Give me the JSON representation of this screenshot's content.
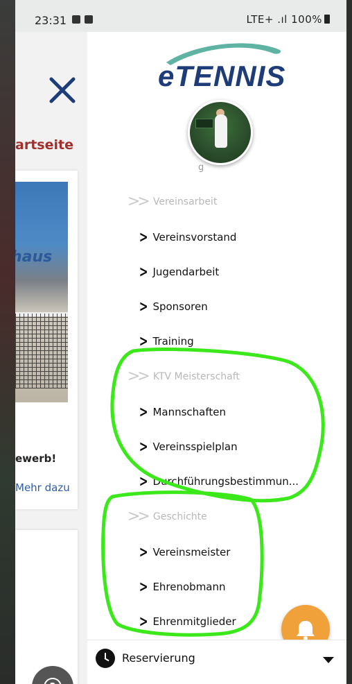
{
  "status_bar": {
    "time": "23:31",
    "network": "LTE+ .ıl",
    "battery": "100%"
  },
  "background_page": {
    "title": "artseite",
    "image_text": "haus",
    "promo_text": "ewerb!",
    "more_link": "Mehr dazu"
  },
  "drawer": {
    "logo_text": "eTENNIS",
    "cut_off_text": "g",
    "sections": [
      {
        "label": "Vereinsarbeit",
        "items": [
          "Vereinsvorstand",
          "Jugendarbeit",
          "Sponsoren",
          "Training"
        ]
      },
      {
        "label": "KTV Meisterschaft",
        "items": [
          "Mannschaften",
          "Vereinsspielplan",
          "Durchführungsbestimmun..."
        ]
      },
      {
        "label": "Geschichte",
        "items": [
          "Vereinsmeister",
          "Ehrenobmann",
          "Ehrenmitglieder"
        ]
      }
    ],
    "bottom_bar": {
      "label": "Reservierung"
    }
  },
  "colors": {
    "logo_blue": "#1e3c78",
    "swoosh_teal": "#5fb3a3",
    "title_red": "#a0302c",
    "link_blue": "#2e5da8",
    "bell_orange": "#f0a13a",
    "annotation_green": "#3be81a"
  },
  "icons": {
    "close": "close-icon",
    "help": "question-icon",
    "bell": "bell-icon",
    "clock": "clock-icon",
    "caret": "caret-down-icon",
    "chevron": "chevron-right-icon",
    "double_chevron": "double-chevron-right-icon"
  }
}
